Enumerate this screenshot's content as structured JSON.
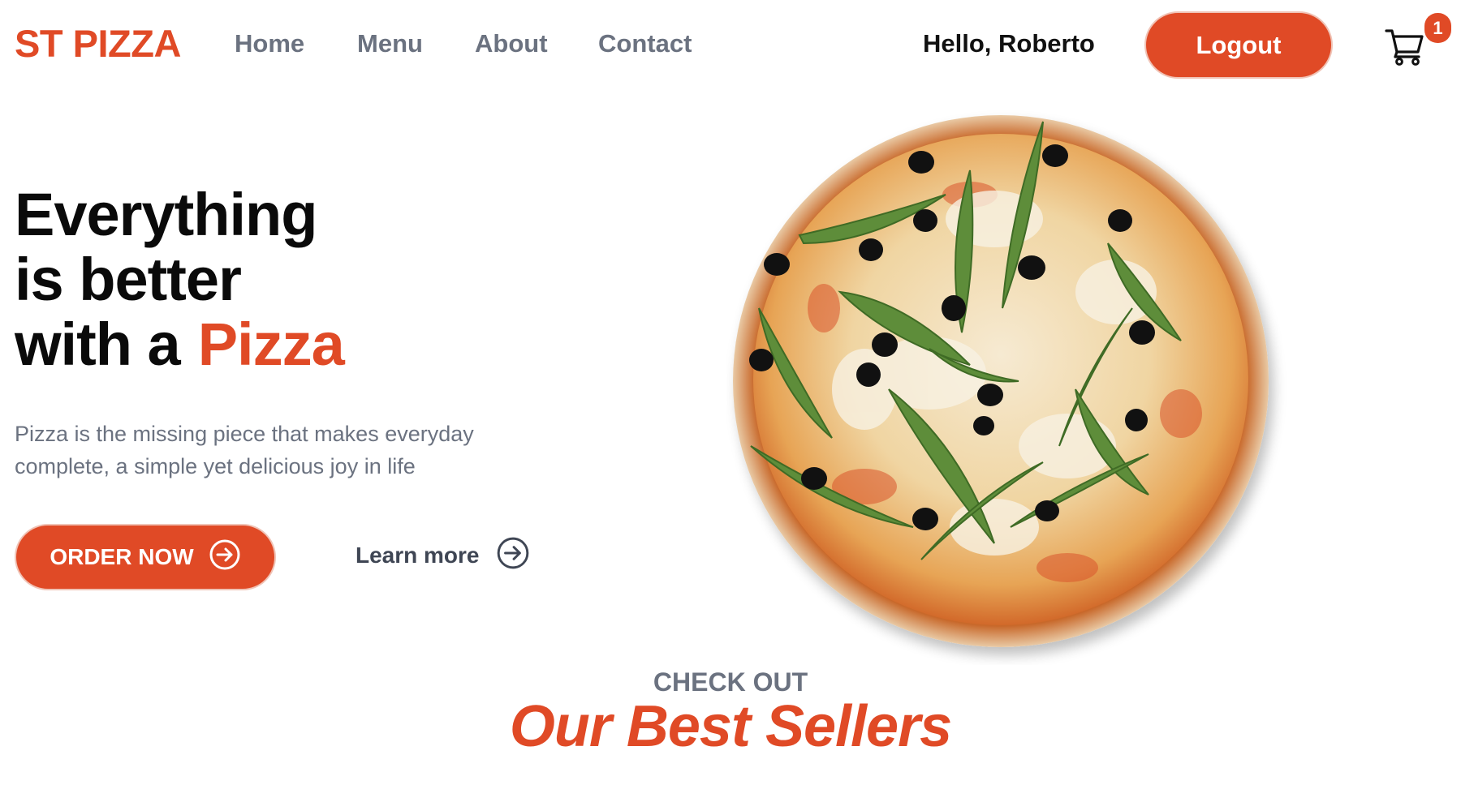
{
  "header": {
    "logo": "ST PIZZA",
    "nav": [
      {
        "label": "Home"
      },
      {
        "label": "Menu"
      },
      {
        "label": "About"
      },
      {
        "label": "Contact"
      }
    ],
    "greeting": "Hello, Roberto",
    "logout_label": "Logout",
    "cart_count": "1"
  },
  "hero": {
    "title_line1": "Everything",
    "title_line2": "is better",
    "title_line3": "with a",
    "title_accent": "Pizza",
    "subtitle": "Pizza is the missing piece that makes everyday complete, a simple yet delicious joy in life",
    "order_label": "ORDER NOW",
    "learn_label": "Learn more"
  },
  "best_sellers": {
    "eyebrow": "CHECK OUT",
    "title": "Our Best Sellers"
  },
  "colors": {
    "accent": "#e04a26",
    "muted": "#6b7280",
    "text": "#0a0a0a"
  },
  "icons": {
    "cart": "shopping-cart-icon",
    "arrow": "arrow-right-circle-icon"
  }
}
